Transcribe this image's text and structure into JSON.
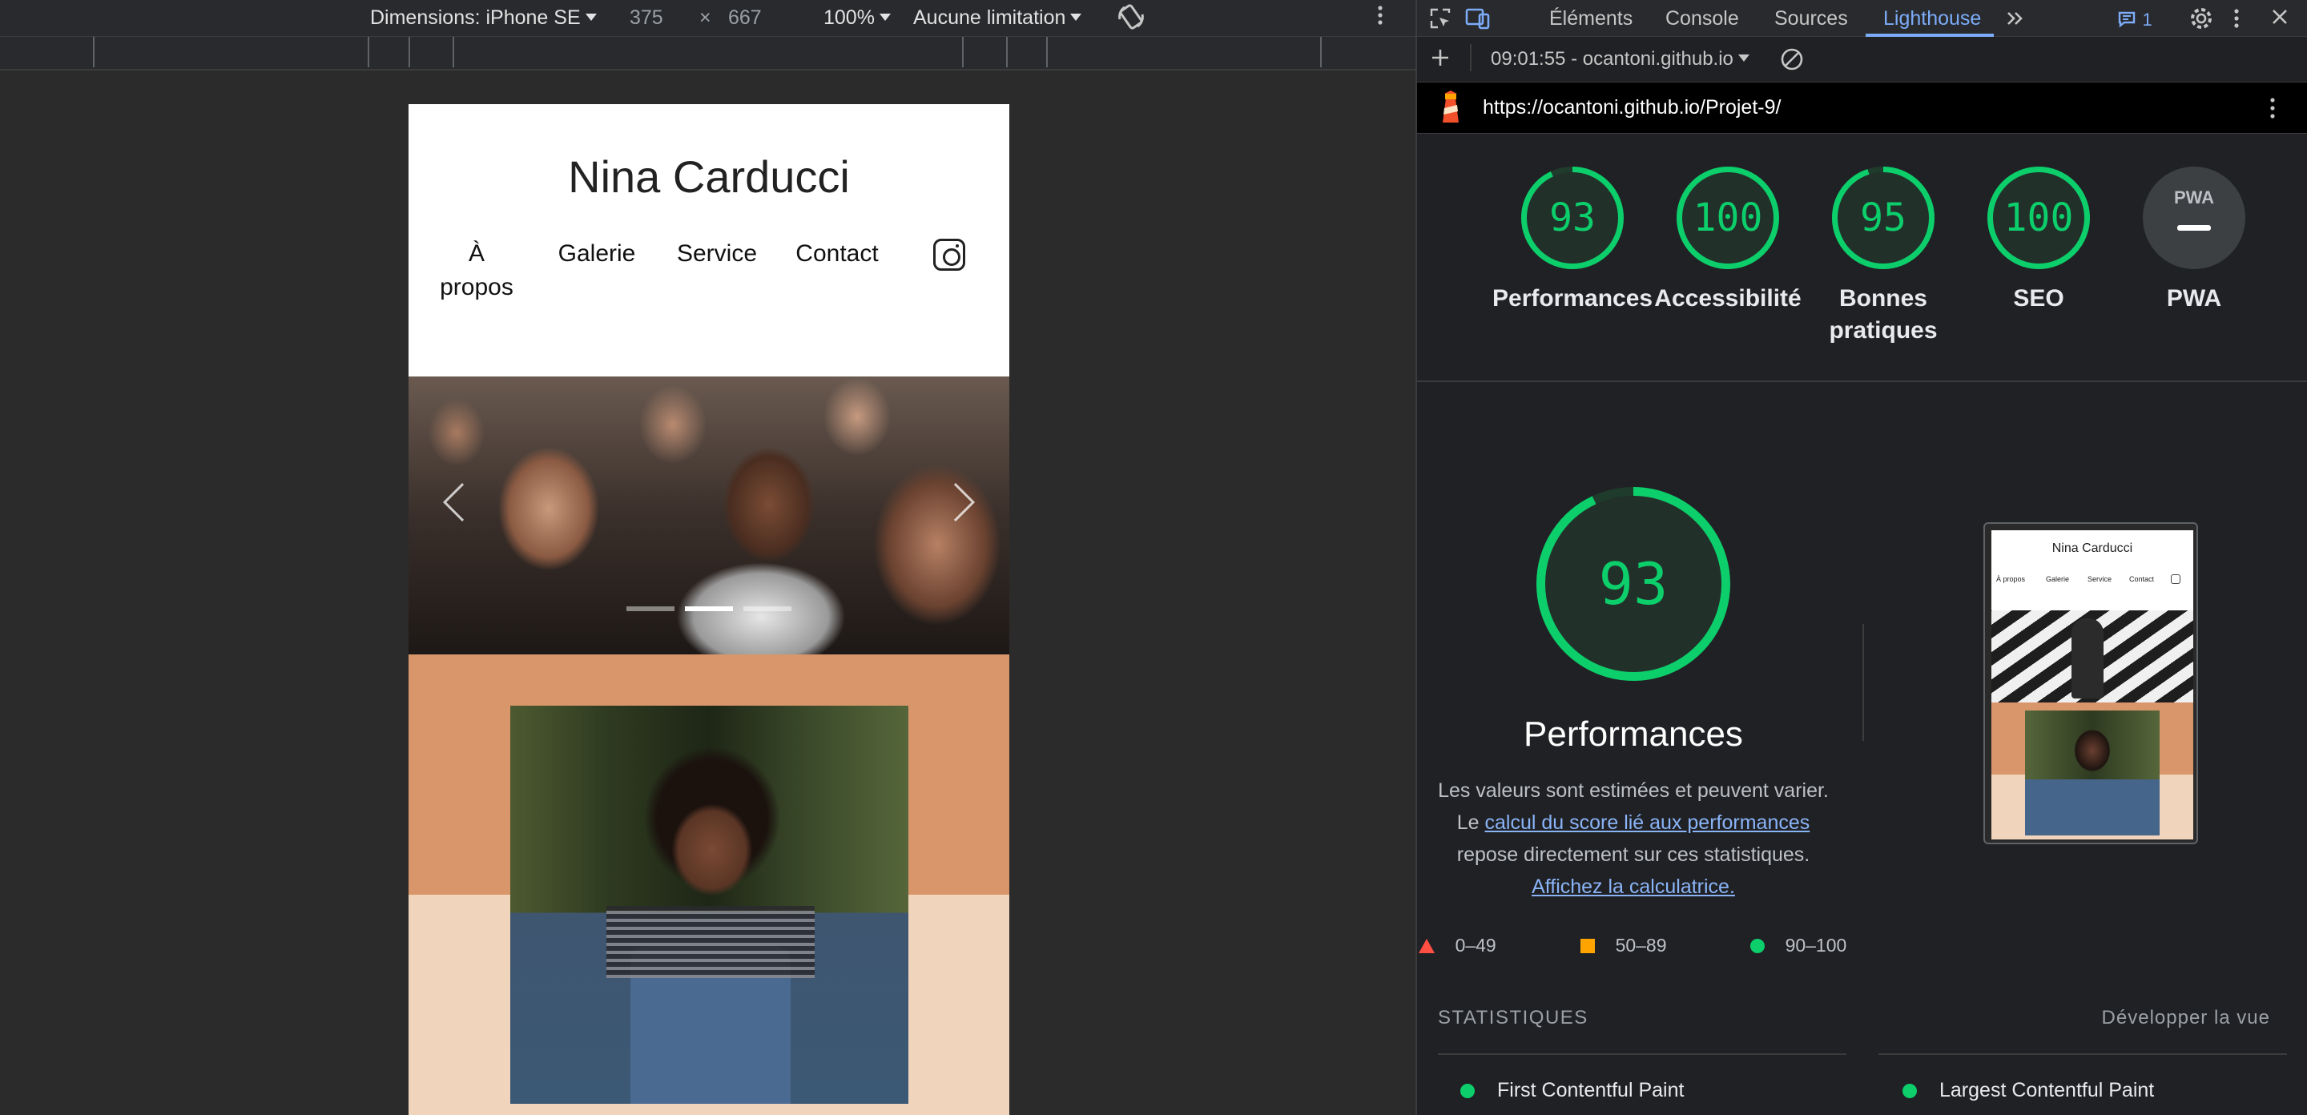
{
  "device_toolbar": {
    "device": "Dimensions: iPhone SE",
    "width": "375",
    "times": "×",
    "height": "667",
    "zoom": "100%",
    "throttle": "Aucune limitation"
  },
  "site": {
    "title": "Nina Carducci",
    "nav": [
      "À\npropos",
      "Galerie",
      "Service",
      "Contact"
    ]
  },
  "carousel": {
    "slide_count": 3,
    "active_index": 1
  },
  "devtools": {
    "tabs": [
      "Éléments",
      "Console",
      "Sources",
      "Lighthouse"
    ],
    "active_tab": "Lighthouse",
    "issues_count": "1",
    "report_selector": "09:01:55 - ocantoni.github.io",
    "url": "https://ocantoni.github.io/Projet-9/"
  },
  "gauges": [
    {
      "label": "Performances",
      "score": "93",
      "value": 93
    },
    {
      "label": "Accessibilité",
      "score": "100",
      "value": 100
    },
    {
      "label": "Bonnes\npratiques",
      "score": "95",
      "value": 95
    },
    {
      "label": "SEO",
      "score": "100",
      "value": 100
    },
    {
      "label": "PWA",
      "score": "PWA",
      "value": null
    }
  ],
  "performance": {
    "score": "93",
    "value": 93,
    "title": "Performances",
    "desc_1": "Les valeurs sont estimées et peuvent varier. Le ",
    "link_1": "calcul du score lié aux performances",
    "desc_2": " repose directement sur ces statistiques. ",
    "link_2": "Affichez la calculatrice."
  },
  "thumbnail": {
    "title": "Nina Carducci",
    "nav": [
      "À propos",
      "Galerie",
      "Service",
      "Contact"
    ]
  },
  "legend": {
    "low": "0–49",
    "mid": "50–89",
    "high": "90–100"
  },
  "stats": {
    "title": "STATISTIQUES",
    "expand": "Développer la vue",
    "metrics": [
      "First Contentful Paint",
      "Largest Contentful Paint"
    ]
  },
  "colors": {
    "pass": "#0cce6b",
    "average": "#ffa400",
    "fail": "#ff4e42",
    "accent": "#7cacf8"
  }
}
